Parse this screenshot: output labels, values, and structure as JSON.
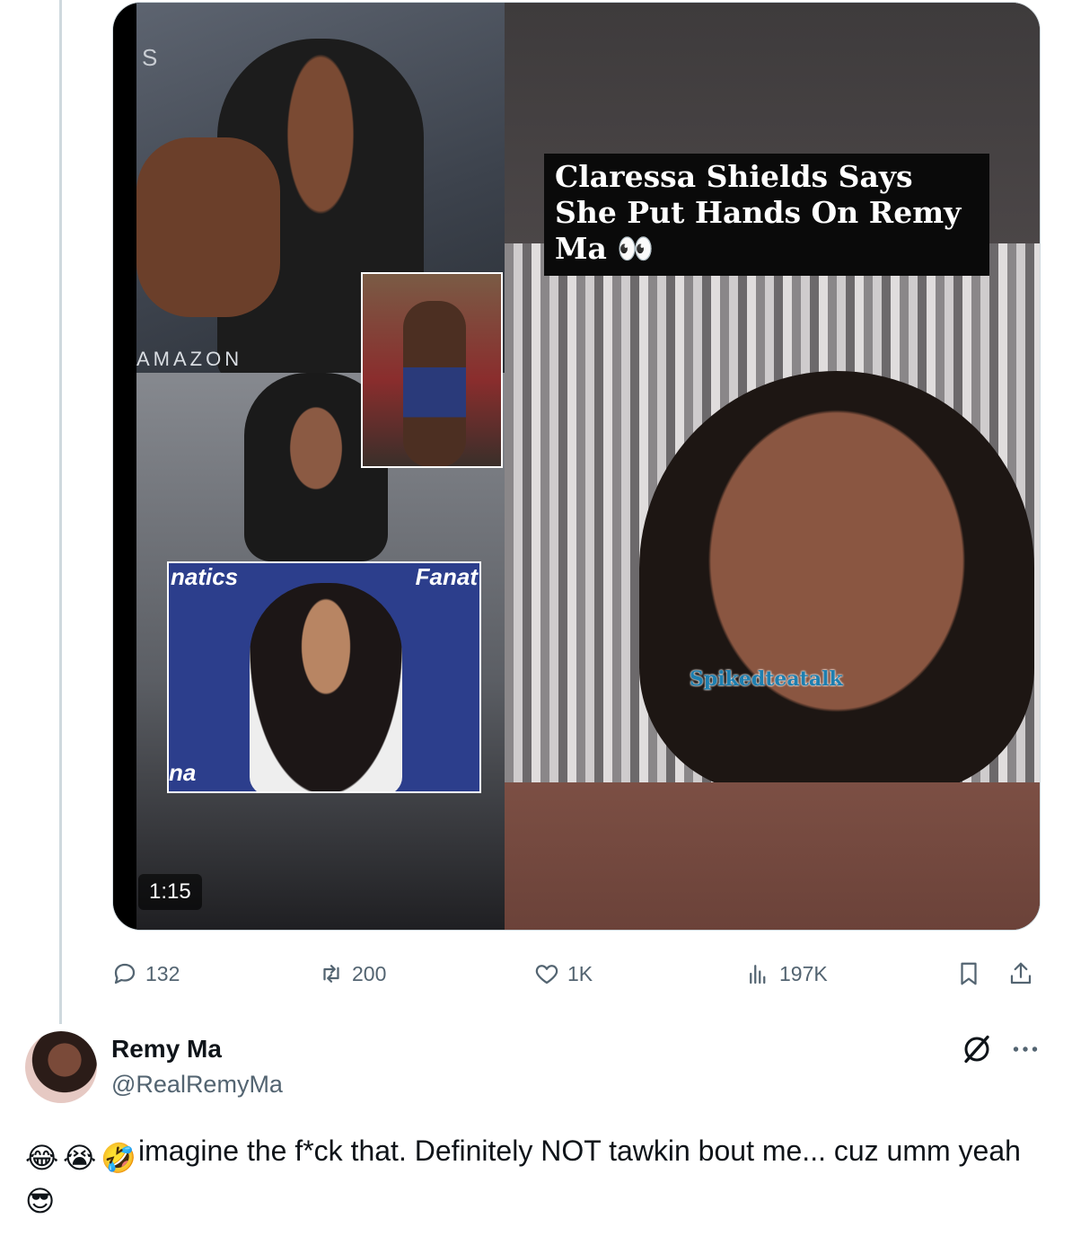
{
  "media": {
    "duration": "1:15",
    "caption": "Claressa Shields Says She Put Hands On Remy Ma 👀",
    "watermark": "Spikedteatalk",
    "photo1_text": [
      "S",
      "AMAZON"
    ],
    "photo4_text": [
      "natics",
      "Fanat",
      "na"
    ]
  },
  "tweet_actions": {
    "replies": "132",
    "reposts": "200",
    "likes": "1K",
    "views": "197K"
  },
  "reply": {
    "author_name": "Remy Ma",
    "author_handle": "@RealRemyMa",
    "emojis_leading": [
      "😂",
      "😭",
      "🤣"
    ],
    "text": "imagine the f*ck that. Definitely NOT tawkin bout me... cuz umm yeah",
    "emoji_trailing": "😎"
  }
}
